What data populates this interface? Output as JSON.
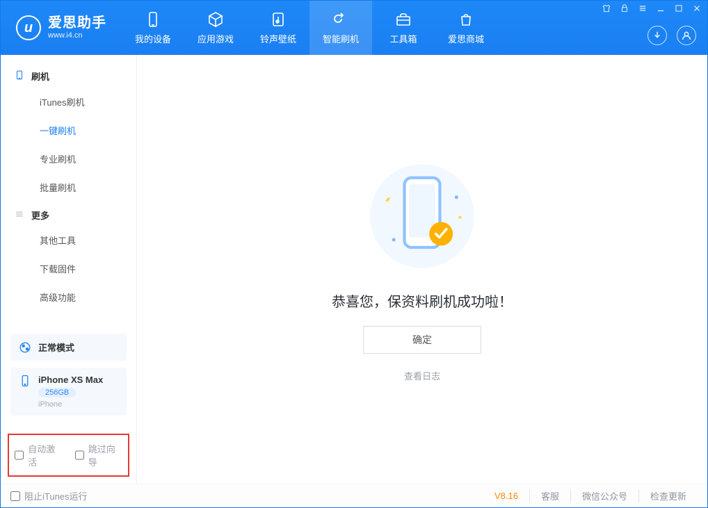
{
  "brand": {
    "name": "爱思助手",
    "url": "www.i4.cn"
  },
  "nav": {
    "items": [
      {
        "label": "我的设备",
        "icon": "phone-icon"
      },
      {
        "label": "应用游戏",
        "icon": "cube-icon"
      },
      {
        "label": "铃声壁纸",
        "icon": "note-icon"
      },
      {
        "label": "智能刷机",
        "icon": "refresh-icon",
        "active": true
      },
      {
        "label": "工具箱",
        "icon": "toolbox-icon"
      },
      {
        "label": "爱思商城",
        "icon": "store-icon"
      }
    ]
  },
  "sidebar": {
    "group1": {
      "title": "刷机"
    },
    "items1": [
      {
        "label": "iTunes刷机"
      },
      {
        "label": "一键刷机",
        "active": true
      },
      {
        "label": "专业刷机"
      },
      {
        "label": "批量刷机"
      }
    ],
    "group2": {
      "title": "更多"
    },
    "items2": [
      {
        "label": "其他工具"
      },
      {
        "label": "下载固件"
      },
      {
        "label": "高级功能"
      }
    ],
    "mode": {
      "label": "正常模式"
    },
    "device": {
      "name": "iPhone XS Max",
      "storage": "256GB",
      "type": "iPhone"
    },
    "checks": {
      "auto_activate": "自动激活",
      "skip_guide": "跳过向导"
    }
  },
  "main": {
    "success_title": "恭喜您，保资料刷机成功啦！",
    "ok_label": "确定",
    "log_label": "查看日志"
  },
  "statusbar": {
    "block_itunes": "阻止iTunes运行",
    "version": "V8.16",
    "links": {
      "service": "客服",
      "wechat": "微信公众号",
      "update": "检查更新"
    }
  },
  "colors": {
    "primary": "#1a7ff2",
    "accent_orange": "#ffb100",
    "danger": "#e53935"
  }
}
